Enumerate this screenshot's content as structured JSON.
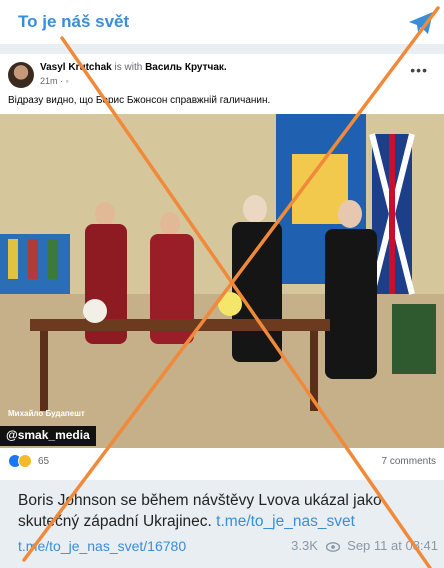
{
  "channel": {
    "title": "To je náš svět"
  },
  "post": {
    "author": "Vasyl Krutchak",
    "with_text": "is with",
    "tagged": "Василь Крутчак.",
    "time": "21m",
    "text": "Відразу видно, що Борис Бжонсон справжній галичанин.",
    "photo": {
      "credit": "Михайло Будапешт",
      "watermark": "@smak_media"
    },
    "reaction_count": "65",
    "comments": "7 comments"
  },
  "message": {
    "caption": "Boris Johnson se během návštěvy Lvova ukázal jako skutečný západní Ukrajinec.",
    "caption_link": "t.me/to_je_nas_svet",
    "link": "t.me/to_je_nas_svet/16780",
    "views": "3.3K",
    "date": "Sep 11 at 08:41"
  },
  "colors": {
    "accent": "#3a8dd8",
    "cross": "#f08a3a"
  },
  "icons": [
    "telegram-icon",
    "more-icon",
    "like-reaction-icon",
    "haha-reaction-icon",
    "eye-icon"
  ]
}
